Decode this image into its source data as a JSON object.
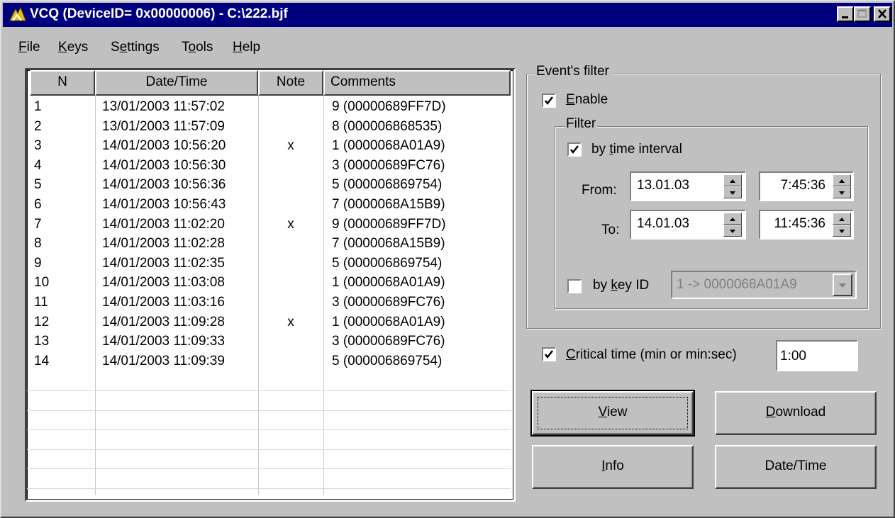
{
  "window": {
    "title": "VCQ (DeviceID= 0x00000006) - C:\\222.bjf"
  },
  "menu": {
    "file_first": "F",
    "file_rest": "ile",
    "keys_first": "K",
    "keys_rest": "eys",
    "settings_pre": "S",
    "settings_u": "e",
    "settings_rest": "ttings",
    "tools_pre": "T",
    "tools_u": "o",
    "tools_rest": "ols",
    "help_first": "H",
    "help_rest": "elp"
  },
  "table": {
    "columns": [
      "N",
      "Date/Time",
      "Note",
      "Comments"
    ],
    "rows": [
      {
        "n": "1",
        "datetime": "13/01/2003 11:57:02",
        "note": "",
        "comment": "9 (00000689FF7D)"
      },
      {
        "n": "2",
        "datetime": "13/01/2003 11:57:09",
        "note": "",
        "comment": "8 (000006868535)"
      },
      {
        "n": "3",
        "datetime": "14/01/2003 10:56:20",
        "note": "x",
        "comment": "1 (0000068A01A9)"
      },
      {
        "n": "4",
        "datetime": "14/01/2003 10:56:30",
        "note": "",
        "comment": "3 (00000689FC76)"
      },
      {
        "n": "5",
        "datetime": "14/01/2003 10:56:36",
        "note": "",
        "comment": "5 (000006869754)"
      },
      {
        "n": "6",
        "datetime": "14/01/2003 10:56:43",
        "note": "",
        "comment": "7 (0000068A15B9)"
      },
      {
        "n": "7",
        "datetime": "14/01/2003 11:02:20",
        "note": "x",
        "comment": "9 (00000689FF7D)"
      },
      {
        "n": "8",
        "datetime": "14/01/2003 11:02:28",
        "note": "",
        "comment": "7 (0000068A15B9)"
      },
      {
        "n": "9",
        "datetime": "14/01/2003 11:02:35",
        "note": "",
        "comment": "5 (000006869754)"
      },
      {
        "n": "10",
        "datetime": "14/01/2003 11:03:08",
        "note": "",
        "comment": "1 (0000068A01A9)"
      },
      {
        "n": "11",
        "datetime": "14/01/2003 11:03:16",
        "note": "",
        "comment": "3 (00000689FC76)"
      },
      {
        "n": "12",
        "datetime": "14/01/2003 11:09:28",
        "note": "x",
        "comment": "1 (0000068A01A9)"
      },
      {
        "n": "13",
        "datetime": "14/01/2003 11:09:33",
        "note": "",
        "comment": "3 (00000689FC76)"
      },
      {
        "n": "14",
        "datetime": "14/01/2003 11:09:39",
        "note": "",
        "comment": "5 (000006869754)"
      }
    ]
  },
  "filter": {
    "group_title": "Event's filter",
    "enable_first": "E",
    "enable_rest": "nable",
    "enable_checked": true,
    "inner_title": "Filter",
    "time_pre": "by ",
    "time_u": "t",
    "time_rest": "ime interval",
    "time_checked": true,
    "from_label": "From:",
    "from_date": "13.01.03",
    "from_time": "7:45:36",
    "to_label": "To:",
    "to_date": "14.01.03",
    "to_time": "11:45:36",
    "key_pre": "by ",
    "key_u": "k",
    "key_rest": "ey ID",
    "key_checked": false,
    "key_value": "1 -> 0000068A01A9"
  },
  "critical": {
    "first": "C",
    "rest": "ritical time (min or min:sec)",
    "checked": true,
    "value": "1:00"
  },
  "buttons": {
    "view_first": "V",
    "view_rest": "iew",
    "download_first": "D",
    "download_rest": "ownload",
    "info_first": "I",
    "info_rest": "nfo",
    "datetime_label": "Date/Time"
  }
}
